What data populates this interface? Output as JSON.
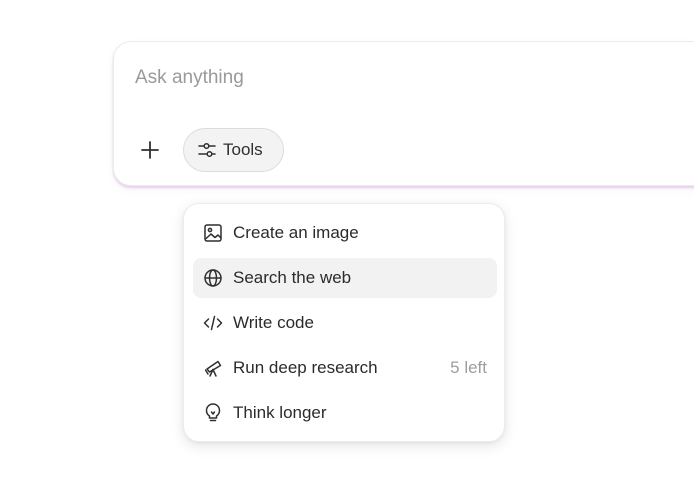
{
  "composer": {
    "placeholder": "Ask anything",
    "tools_label": "Tools"
  },
  "menu": {
    "items": [
      {
        "label": "Create an image",
        "icon": "image-icon",
        "badge": ""
      },
      {
        "label": "Search the web",
        "icon": "globe-icon",
        "badge": "",
        "highlighted": true
      },
      {
        "label": "Write code",
        "icon": "code-icon",
        "badge": ""
      },
      {
        "label": "Run deep research",
        "icon": "telescope-icon",
        "badge": "5 left"
      },
      {
        "label": "Think longer",
        "icon": "lightbulb-icon",
        "badge": ""
      }
    ]
  },
  "colors": {
    "composer_glow": "#d296dc",
    "highlight_bg": "#f2f2f2",
    "badge_text": "#9e9e9e"
  }
}
